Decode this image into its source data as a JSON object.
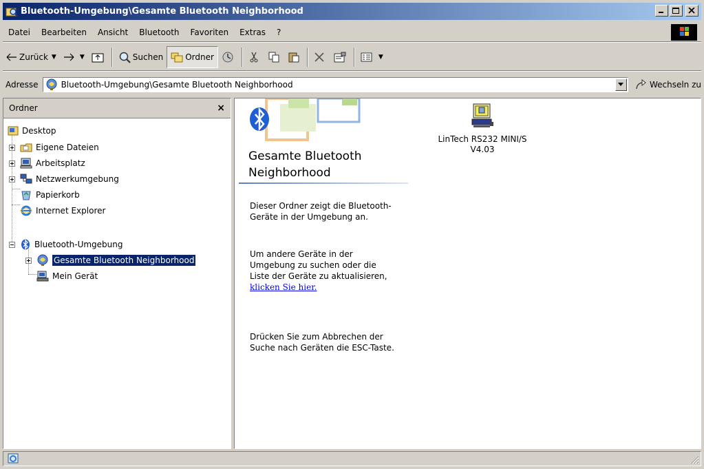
{
  "window": {
    "title": "Bluetooth-Umgebung\\Gesamte Bluetooth Neighborhood"
  },
  "menubar": {
    "items": [
      "Datei",
      "Bearbeiten",
      "Ansicht",
      "Bluetooth",
      "Favoriten",
      "Extras",
      "?"
    ]
  },
  "toolbar": {
    "back_label": "Zurück",
    "search_label": "Suchen",
    "folders_label": "Ordner"
  },
  "address": {
    "label": "Adresse",
    "value": "Bluetooth-Umgebung\\Gesamte Bluetooth Neighborhood",
    "go_label": "Wechseln zu"
  },
  "folders_pane": {
    "title": "Ordner",
    "close_label": "×",
    "tree": [
      {
        "label": "Desktop",
        "icon": "desktop-icon",
        "selected": false
      },
      {
        "label": "Eigene Dateien",
        "icon": "my-documents-icon",
        "selected": false
      },
      {
        "label": "Arbeitsplatz",
        "icon": "my-computer-icon",
        "selected": false
      },
      {
        "label": "Netzwerkumgebung",
        "icon": "network-icon",
        "selected": false
      },
      {
        "label": "Papierkorb",
        "icon": "recycle-bin-icon",
        "selected": false
      },
      {
        "label": "Internet Explorer",
        "icon": "internet-explorer-icon",
        "selected": false
      },
      {
        "label": "Bluetooth-Umgebung",
        "icon": "bluetooth-icon",
        "selected": false
      },
      {
        "label": "Gesamte Bluetooth Neighborhood",
        "icon": "bluetooth-neighborhood-icon",
        "selected": true
      },
      {
        "label": "Mein Gerät",
        "icon": "my-device-icon",
        "selected": false
      }
    ]
  },
  "webview": {
    "title": "Gesamte Bluetooth Neighborhood",
    "para1": "Dieser Ordner zeigt die Bluetooth-Geräte in der Umgebung an.",
    "para2": "Um andere Geräte in der Umgebung zu suchen oder die Liste der Geräte zu aktualisieren,",
    "link": "klicken Sie hier.",
    "para3": "Drücken Sie zum Abbrechen der Suche nach Geräten die ESC-Taste."
  },
  "devices": [
    {
      "name_line1": "LinTech RS232 MINI/S",
      "name_line2": "V4.03",
      "icon": "bluetooth-device-computer-icon"
    }
  ],
  "colors": {
    "title_start": "#0a246a",
    "title_end": "#a6caf0",
    "selection": "#0a246a",
    "link": "#0000ee"
  }
}
